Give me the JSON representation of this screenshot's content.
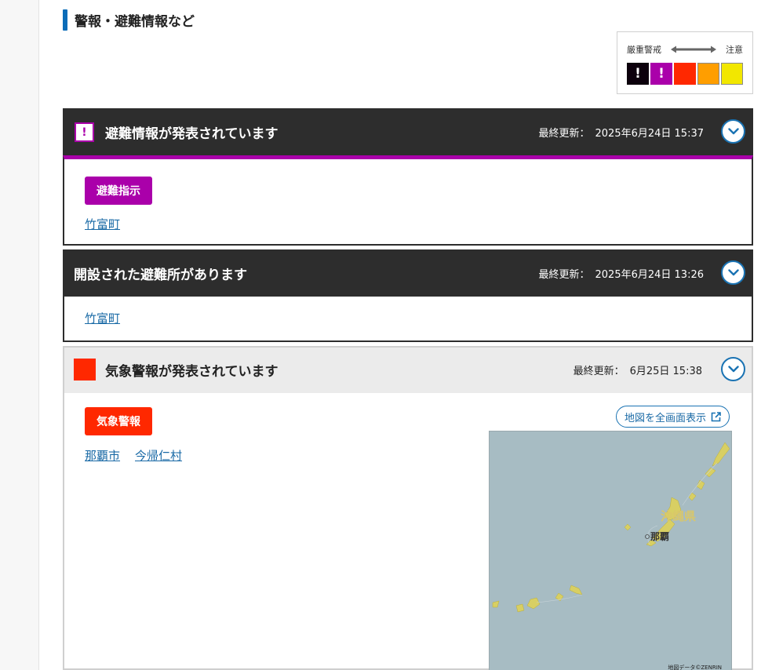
{
  "section": {
    "title": "警報・避難情報など"
  },
  "legend": {
    "left_label": "厳重警戒",
    "right_label": "注意",
    "swatches": [
      {
        "name": "black",
        "color": "#0c000c",
        "mark": "!"
      },
      {
        "name": "purple",
        "color": "#aa00aa",
        "mark": "!"
      },
      {
        "name": "red",
        "color": "#ff2800",
        "mark": ""
      },
      {
        "name": "orange",
        "color": "#ff9e00",
        "mark": ""
      },
      {
        "name": "yellow",
        "color": "#f2e700",
        "mark": ""
      }
    ]
  },
  "evacuation": {
    "icon_mark": "!",
    "title": "避難情報が発表されています",
    "updated_label": "最終更新：",
    "updated_value": "2025年6月24日 15:37",
    "badge": "避難指示",
    "areas": [
      "竹富町"
    ],
    "accent_color": "#aa00aa"
  },
  "shelter": {
    "title": "開設された避難所があります",
    "updated_label": "最終更新：",
    "updated_value": "2025年6月24日 13:26",
    "areas": [
      "竹富町"
    ]
  },
  "warning": {
    "title": "気象警報が発表されています",
    "updated_label": "最終更新：",
    "updated_value": "6月25日 15:38",
    "badge": "気象警報",
    "areas": [
      "那覇市",
      "今帰仁村"
    ],
    "accent_color": "#ff2800",
    "map_button": "地図を全画面表示",
    "map": {
      "pref_label": "沖縄県",
      "city_label": "那覇",
      "credit": "地図データ©ZENRIN"
    }
  }
}
